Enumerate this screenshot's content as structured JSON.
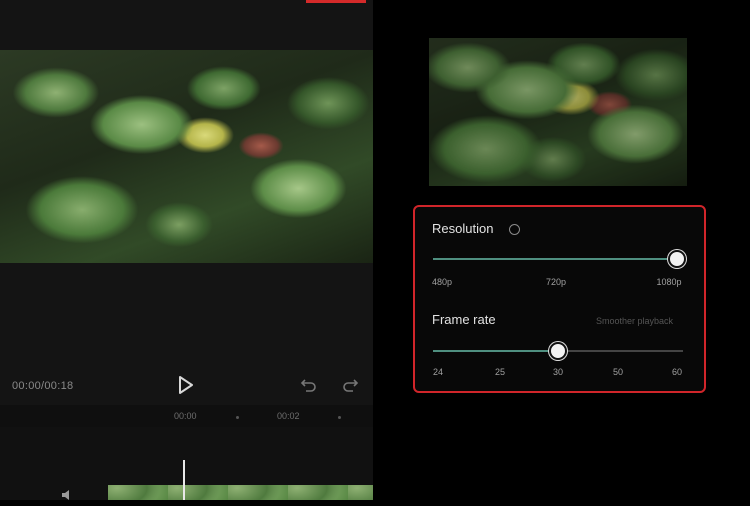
{
  "editor": {
    "time": "00:00/00:18",
    "ruler_marks": [
      "00:00",
      "00:02"
    ]
  },
  "export_settings": {
    "resolution": {
      "label": "Resolution",
      "options": [
        "480p",
        "720p",
        "1080p"
      ],
      "selected": "1080p",
      "level": 1.0
    },
    "frame_rate": {
      "label": "Frame rate",
      "hint": "Smoother playback",
      "options": [
        "24",
        "25",
        "30",
        "50",
        "60"
      ],
      "selected": "30",
      "level": 0.5
    }
  },
  "colors": {
    "accent": "#4f8f80",
    "highlight": "#d1252a"
  },
  "icons": [
    "play-icon",
    "undo-icon",
    "redo-icon",
    "info-icon",
    "audio-icon"
  ]
}
